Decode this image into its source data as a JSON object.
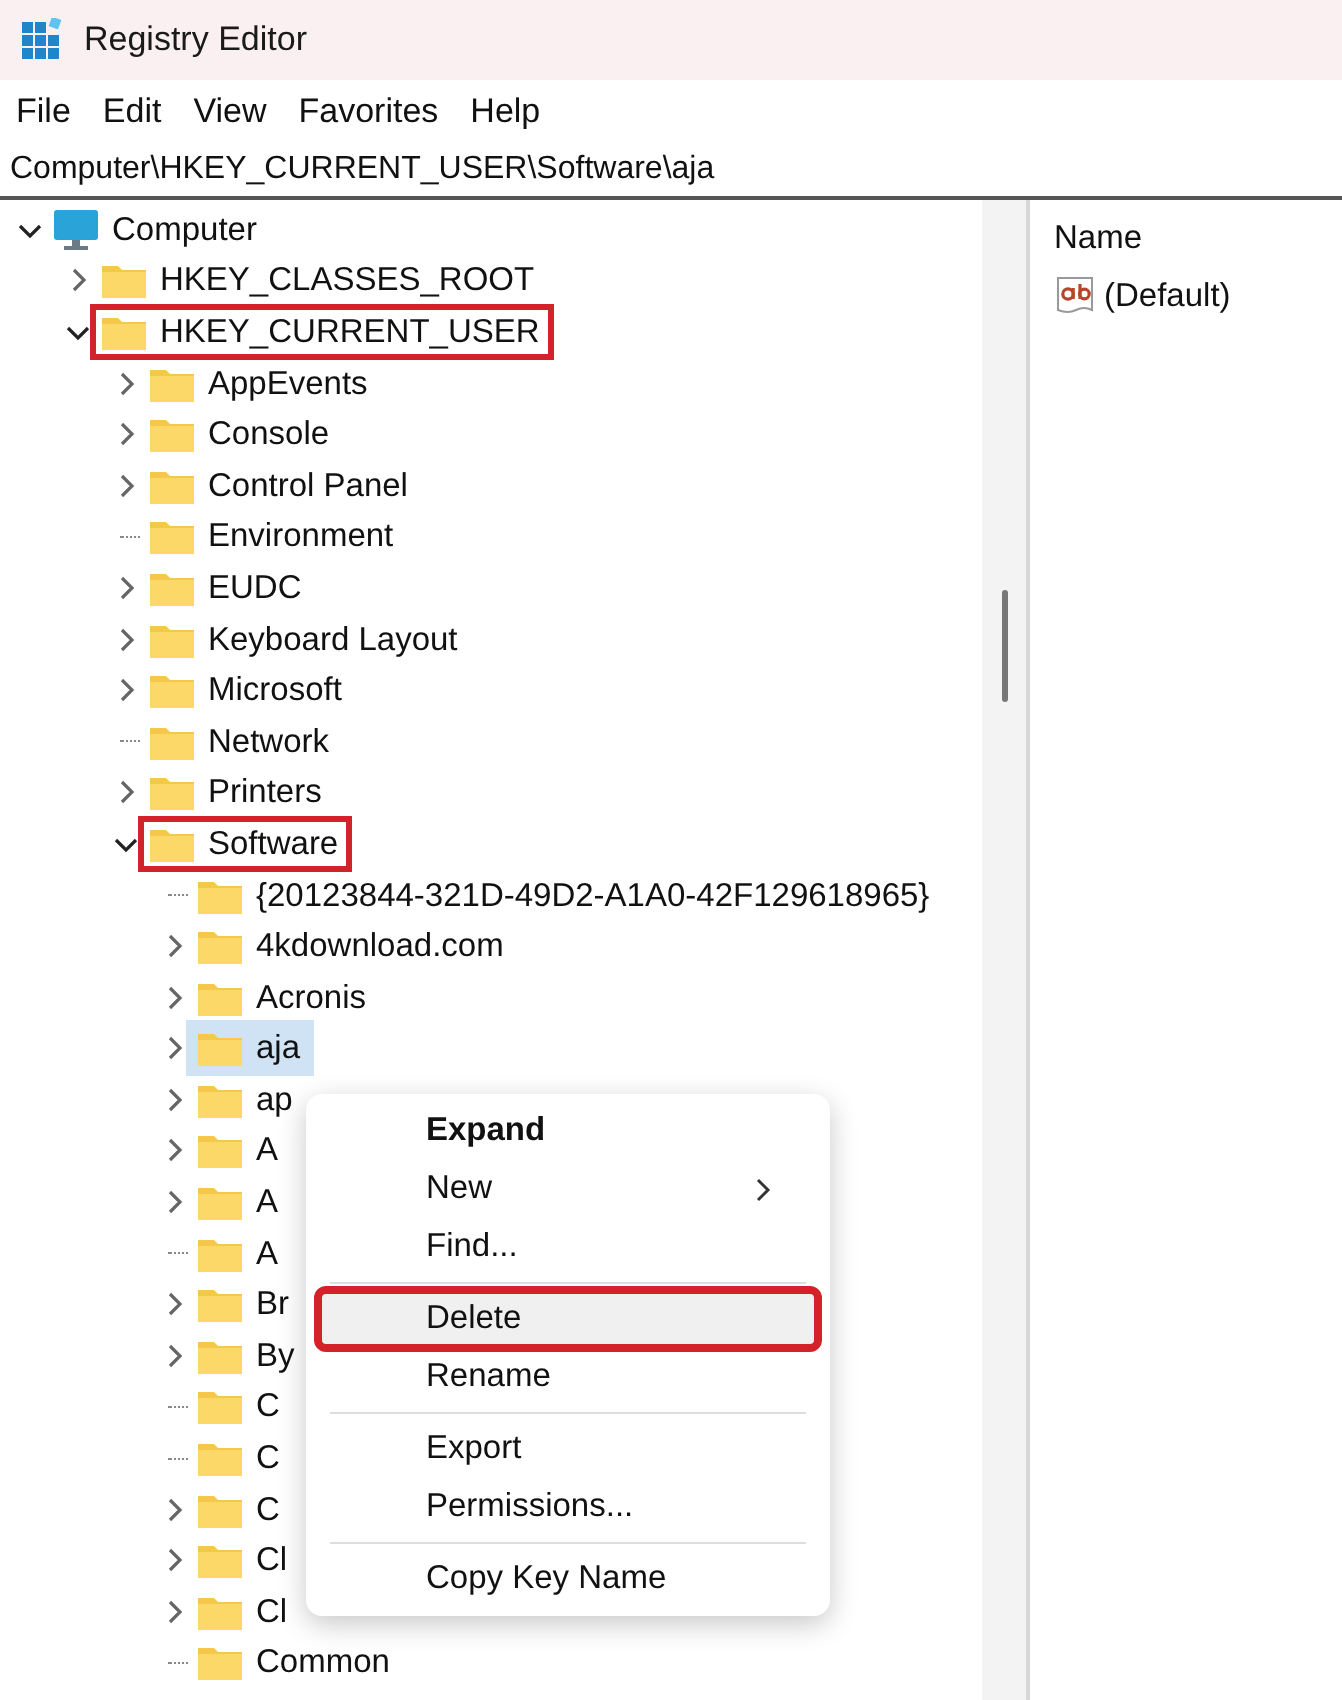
{
  "window": {
    "title": "Registry Editor"
  },
  "menu_bar": [
    "File",
    "Edit",
    "View",
    "Favorites",
    "Help"
  ],
  "address_bar": {
    "value": "Computer\\HKEY_CURRENT_USER\\Software\\aja"
  },
  "tree": [
    {
      "label": "Computer",
      "kind": "computer",
      "expandable": true,
      "expanded": true,
      "selected": false,
      "highlighted": false,
      "children": [
        {
          "label": "HKEY_CLASSES_ROOT",
          "kind": "folder",
          "expandable": true,
          "expanded": false,
          "selected": false,
          "highlighted": false
        },
        {
          "label": "HKEY_CURRENT_USER",
          "kind": "folder",
          "expandable": true,
          "expanded": true,
          "selected": false,
          "highlighted": true,
          "children": [
            {
              "label": "AppEvents",
              "kind": "folder",
              "expandable": true,
              "expanded": false,
              "selected": false,
              "highlighted": false
            },
            {
              "label": "Console",
              "kind": "folder",
              "expandable": true,
              "expanded": false,
              "selected": false,
              "highlighted": false
            },
            {
              "label": "Control Panel",
              "kind": "folder",
              "expandable": true,
              "expanded": false,
              "selected": false,
              "highlighted": false
            },
            {
              "label": "Environment",
              "kind": "folder",
              "expandable": false,
              "selected": false,
              "highlighted": false
            },
            {
              "label": "EUDC",
              "kind": "folder",
              "expandable": true,
              "expanded": false,
              "selected": false,
              "highlighted": false
            },
            {
              "label": "Keyboard Layout",
              "kind": "folder",
              "expandable": true,
              "expanded": false,
              "selected": false,
              "highlighted": false
            },
            {
              "label": "Microsoft",
              "kind": "folder",
              "expandable": true,
              "expanded": false,
              "selected": false,
              "highlighted": false
            },
            {
              "label": "Network",
              "kind": "folder",
              "expandable": false,
              "selected": false,
              "highlighted": false
            },
            {
              "label": "Printers",
              "kind": "folder",
              "expandable": true,
              "expanded": false,
              "selected": false,
              "highlighted": false
            },
            {
              "label": "Software",
              "kind": "folder",
              "expandable": true,
              "expanded": true,
              "selected": false,
              "highlighted": true,
              "children": [
                {
                  "label": "{20123844-321D-49D2-A1A0-42F129618965}",
                  "kind": "folder",
                  "expandable": false,
                  "selected": false,
                  "highlighted": false
                },
                {
                  "label": "4kdownload.com",
                  "kind": "folder",
                  "expandable": true,
                  "expanded": false,
                  "selected": false,
                  "highlighted": false
                },
                {
                  "label": "Acronis",
                  "kind": "folder",
                  "expandable": true,
                  "expanded": false,
                  "selected": false,
                  "highlighted": false
                },
                {
                  "label": "aja",
                  "kind": "folder",
                  "expandable": true,
                  "expanded": false,
                  "selected": true,
                  "highlighted": false
                },
                {
                  "label": "ap",
                  "kind": "folder",
                  "expandable": true,
                  "expanded": false,
                  "selected": false,
                  "highlighted": false
                },
                {
                  "label": "A",
                  "kind": "folder",
                  "expandable": true,
                  "expanded": false,
                  "selected": false,
                  "highlighted": false
                },
                {
                  "label": "A",
                  "kind": "folder",
                  "expandable": true,
                  "expanded": false,
                  "selected": false,
                  "highlighted": false
                },
                {
                  "label": "A",
                  "kind": "folder",
                  "expandable": false,
                  "selected": false,
                  "highlighted": false
                },
                {
                  "label": "Br",
                  "kind": "folder",
                  "expandable": true,
                  "expanded": false,
                  "selected": false,
                  "highlighted": false
                },
                {
                  "label": "By",
                  "kind": "folder",
                  "expandable": true,
                  "expanded": false,
                  "selected": false,
                  "highlighted": false
                },
                {
                  "label": "C",
                  "kind": "folder",
                  "expandable": false,
                  "selected": false,
                  "highlighted": false
                },
                {
                  "label": "C",
                  "kind": "folder",
                  "expandable": false,
                  "selected": false,
                  "highlighted": false
                },
                {
                  "label": "C",
                  "kind": "folder",
                  "expandable": true,
                  "expanded": false,
                  "selected": false,
                  "highlighted": false
                },
                {
                  "label": "Cl",
                  "kind": "folder",
                  "expandable": true,
                  "expanded": false,
                  "selected": false,
                  "highlighted": false
                },
                {
                  "label": "Cl",
                  "kind": "folder",
                  "expandable": true,
                  "expanded": false,
                  "selected": false,
                  "highlighted": false
                },
                {
                  "label": "Common",
                  "kind": "folder",
                  "expandable": false,
                  "selected": false,
                  "highlighted": false
                }
              ]
            }
          ]
        }
      ]
    }
  ],
  "values_pane": {
    "column": "Name",
    "rows": [
      {
        "name": "(Default)",
        "kind": "string"
      }
    ]
  },
  "context_menu": [
    {
      "kind": "item",
      "label": "Expand",
      "bold": true,
      "submenu": false,
      "highlighted": false
    },
    {
      "kind": "item",
      "label": "New",
      "bold": false,
      "submenu": true,
      "highlighted": false
    },
    {
      "kind": "item",
      "label": "Find...",
      "bold": false,
      "submenu": false,
      "highlighted": false
    },
    {
      "kind": "separator"
    },
    {
      "kind": "item",
      "label": "Delete",
      "bold": false,
      "submenu": false,
      "highlighted": true
    },
    {
      "kind": "item",
      "label": "Rename",
      "bold": false,
      "submenu": false,
      "highlighted": false
    },
    {
      "kind": "separator"
    },
    {
      "kind": "item",
      "label": "Export",
      "bold": false,
      "submenu": false,
      "highlighted": false
    },
    {
      "kind": "item",
      "label": "Permissions...",
      "bold": false,
      "submenu": false,
      "highlighted": false
    },
    {
      "kind": "separator"
    },
    {
      "kind": "item",
      "label": "Copy Key Name",
      "bold": false,
      "submenu": false,
      "highlighted": false
    }
  ]
}
